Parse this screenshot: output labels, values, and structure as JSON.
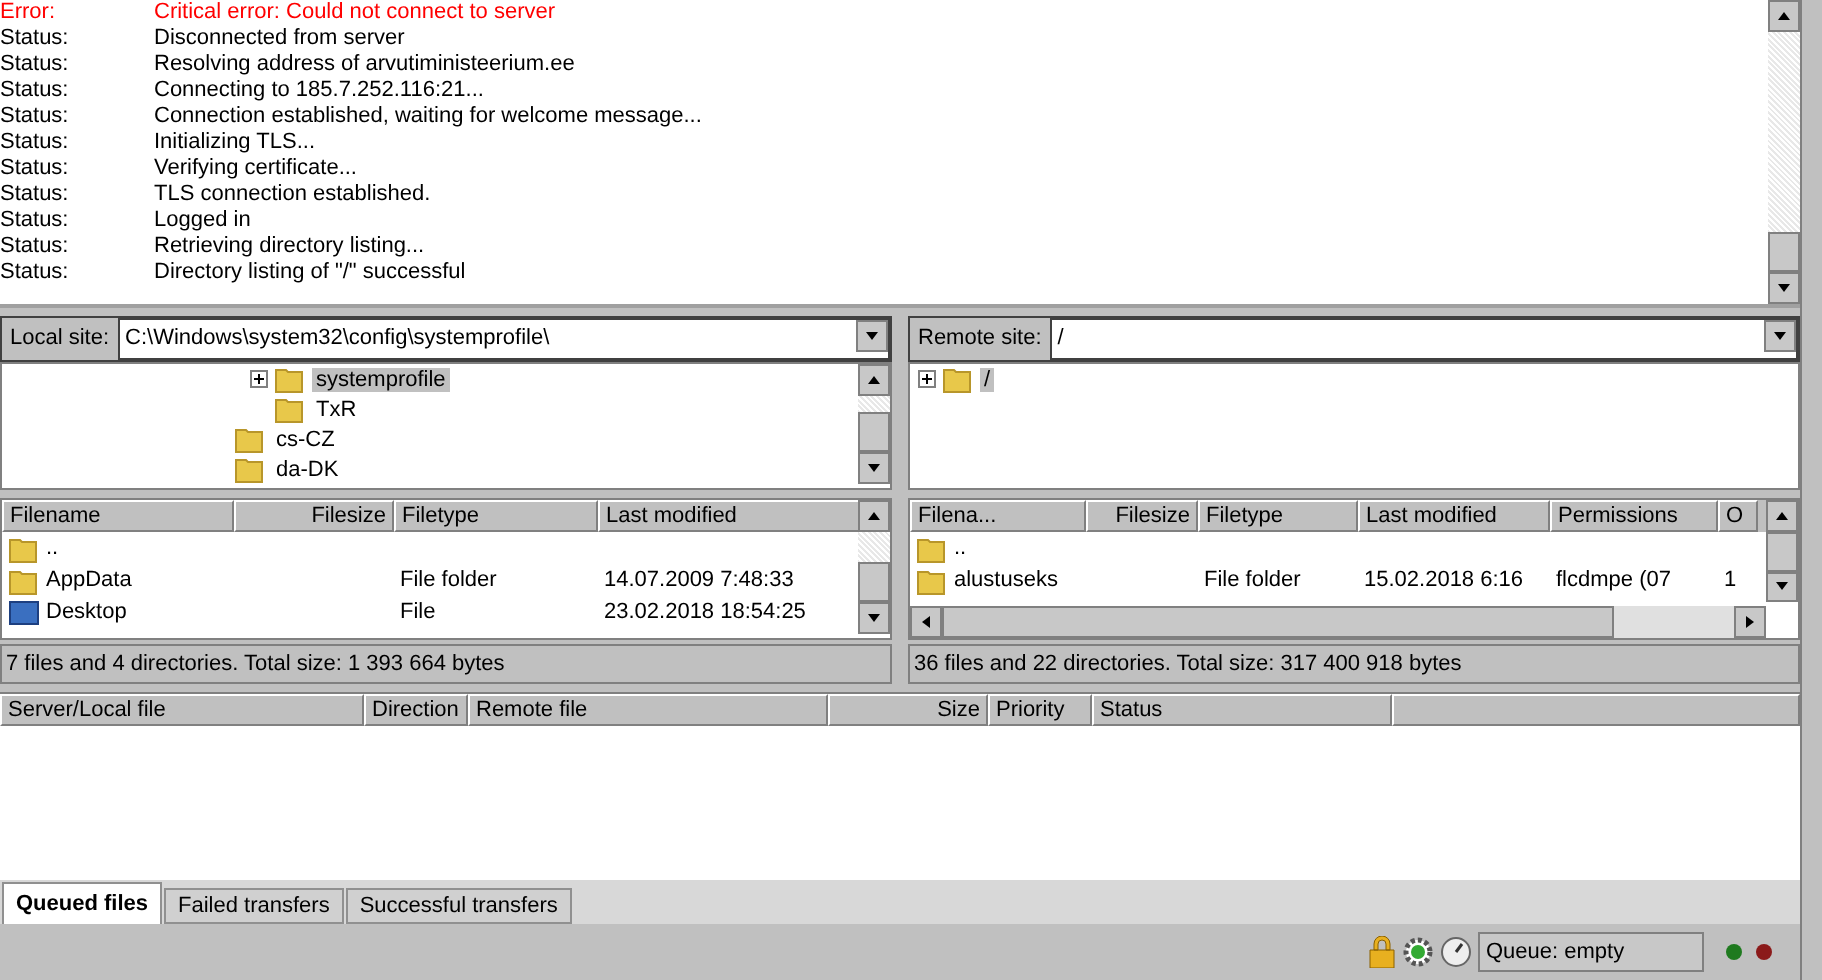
{
  "log": [
    {
      "kind": "error",
      "label": "Error:",
      "message": "Critical error: Could not connect to server"
    },
    {
      "kind": "status",
      "label": "Status:",
      "message": "Disconnected from server"
    },
    {
      "kind": "status",
      "label": "Status:",
      "message": "Resolving address of arvutiministeerium.ee"
    },
    {
      "kind": "status",
      "label": "Status:",
      "message": "Connecting to 185.7.252.116:21..."
    },
    {
      "kind": "status",
      "label": "Status:",
      "message": "Connection established, waiting for welcome message..."
    },
    {
      "kind": "status",
      "label": "Status:",
      "message": "Initializing TLS..."
    },
    {
      "kind": "status",
      "label": "Status:",
      "message": "Verifying certificate..."
    },
    {
      "kind": "status",
      "label": "Status:",
      "message": "TLS connection established."
    },
    {
      "kind": "status",
      "label": "Status:",
      "message": "Logged in"
    },
    {
      "kind": "status",
      "label": "Status:",
      "message": "Retrieving directory listing..."
    },
    {
      "kind": "status",
      "label": "Status:",
      "message": "Directory listing of \"/\" successful"
    }
  ],
  "local": {
    "site_label": "Local site:",
    "path": "C:\\Windows\\system32\\config\\systemprofile\\",
    "tree": [
      {
        "children": [
          {
            "label": "systemprofile",
            "expandable": true,
            "selected": true
          },
          {
            "label": "TxR",
            "expandable": false,
            "selected": false
          }
        ]
      },
      {
        "label": "cs-CZ",
        "expandable": false,
        "selected": false
      },
      {
        "label": "da-DK",
        "expandable": false,
        "selected": false
      }
    ],
    "columns": [
      "Filename",
      "Filesize",
      "Filetype",
      "Last modified"
    ],
    "rows": [
      {
        "kind": "folder",
        "cells": [
          "..",
          "",
          "",
          ""
        ]
      },
      {
        "kind": "folder",
        "cells": [
          "AppData",
          "",
          "File folder",
          "14.07.2009 7:48:33"
        ]
      },
      {
        "kind": "file",
        "cells": [
          "Desktop",
          "",
          "File",
          "23.02.2018 18:54:25"
        ]
      }
    ],
    "summary": "7 files and 4 directories. Total size: 1 393 664 bytes"
  },
  "remote": {
    "site_label": "Remote site:",
    "path": "/",
    "tree": [
      {
        "label": "/",
        "expandable": true,
        "selected": true
      }
    ],
    "columns": [
      "Filena...",
      "Filesize",
      "Filetype",
      "Last modified",
      "Permissions",
      "O"
    ],
    "rows": [
      {
        "kind": "folder",
        "cells": [
          "..",
          "",
          "",
          "",
          "",
          ""
        ]
      },
      {
        "kind": "folder",
        "cells": [
          "alustuseks",
          "",
          "File folder",
          "15.02.2018 6:16",
          "flcdmpe (07",
          "1"
        ]
      }
    ],
    "summary": "36 files and 22 directories. Total size: 317 400 918 bytes"
  },
  "queue": {
    "columns": [
      "Server/Local file",
      "Direction",
      "Remote file",
      "Size",
      "Priority",
      "Status"
    ]
  },
  "tabs": [
    {
      "label": "Queued files",
      "selected": true
    },
    {
      "label": "Failed transfers",
      "selected": false
    },
    {
      "label": "Successful transfers",
      "selected": false
    }
  ],
  "status_bar": {
    "queue": "Queue: empty",
    "lights": [
      {
        "color": "#1f7a1f"
      },
      {
        "color": "#8b1a1a"
      }
    ]
  }
}
